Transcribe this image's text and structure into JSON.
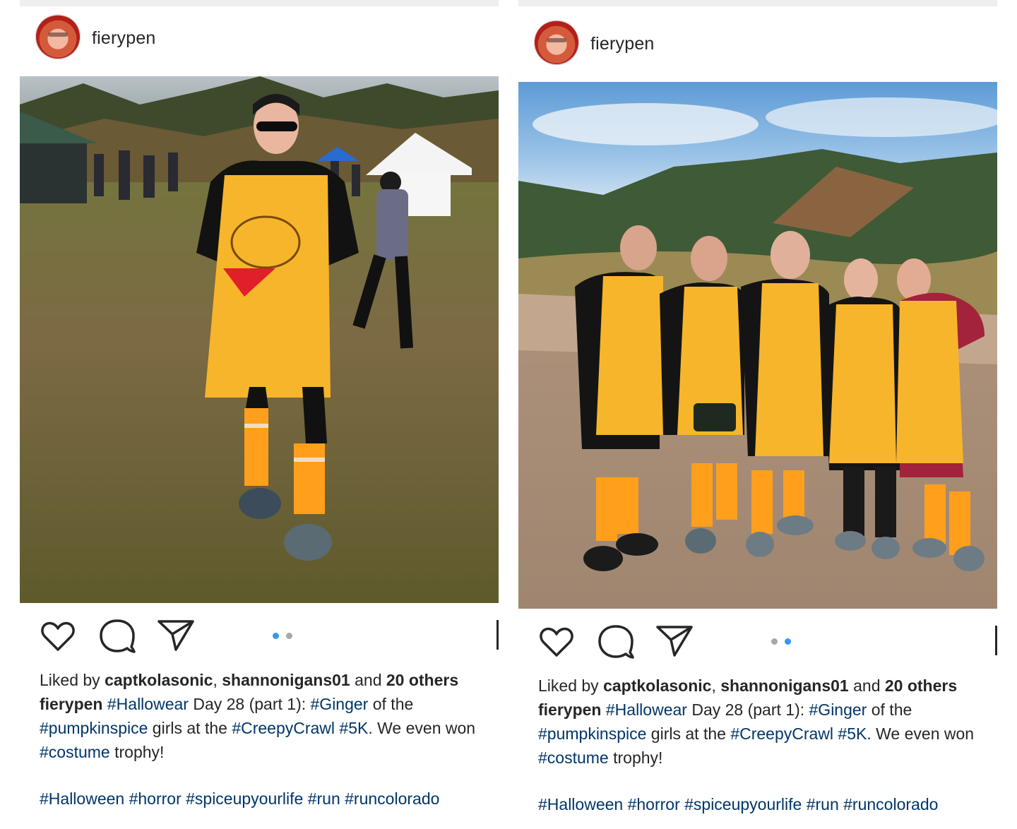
{
  "posts": [
    {
      "username": "fierypen",
      "carousel_active_index": 0,
      "carousel_count": 2,
      "liked_by_prefix": "Liked by ",
      "liked_user_1": "captkolasonic",
      "liked_sep": ", ",
      "liked_user_2": "shannonigans01",
      "liked_and": " and ",
      "liked_others": "20 others",
      "caption_user": "fierypen",
      "t1": " ",
      "tag_hallowear": "#Hallowear",
      "t2": " Day 28 (part 1): ",
      "tag_ginger": "#Ginger",
      "t3": " of the",
      "tag_pumpkinspice": "#pumpkinspice",
      "t4": " girls at the ",
      "tag_creepycrawl": "#CreepyCrawl",
      "t5": " ",
      "tag_5k": "#5K",
      "t6": ". We even won",
      "tag_costume": "#costume",
      "t7": " trophy!",
      "tags_line": "#Halloween #horror #spiceupyourlife #run #runcolorado"
    },
    {
      "username": "fierypen",
      "carousel_active_index": 1,
      "carousel_count": 2,
      "liked_by_prefix": "Liked by ",
      "liked_user_1": "captkolasonic",
      "liked_sep": ", ",
      "liked_user_2": "shannonigans01",
      "liked_and": " and ",
      "liked_others": "20 others",
      "caption_user": "fierypen",
      "t1": " ",
      "tag_hallowear": "#Hallowear",
      "t2": " Day 28 (part 1): ",
      "tag_ginger": "#Ginger",
      "t3": " of the",
      "tag_pumpkinspice": "#pumpkinspice",
      "t4": " girls at the ",
      "tag_creepycrawl": "#CreepyCrawl",
      "t5": " ",
      "tag_5k": "#5K",
      "t6": ". We even won",
      "tag_costume": "#costume",
      "t7": " trophy!",
      "tags_line": "#Halloween #horror #spiceupyourlife #run #runcolorado"
    }
  ],
  "icons": [
    "heart-icon",
    "comment-icon",
    "share-icon"
  ],
  "colors": {
    "text": "#262626",
    "hashtag": "#003569",
    "dot_active": "#3897f0",
    "dot_inactive": "#a8a8a8",
    "apron": "#f7b52b",
    "sock_orange": "#ff9f1c"
  }
}
